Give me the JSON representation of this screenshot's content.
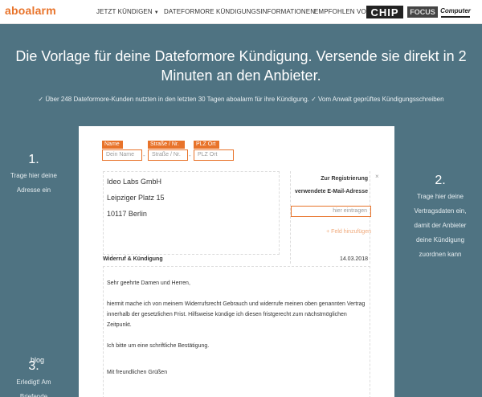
{
  "header": {
    "logo": "aboalarm",
    "nav": {
      "kuendigen": "JETZT KÜNDIGEN",
      "info": "DATEFORMORE KÜNDIGUNGSINFORMATIONEN",
      "empfohlen": "EMPFOHLEN VON"
    },
    "brands": [
      "CHIP",
      "FOCUS",
      "Computer"
    ]
  },
  "hero": {
    "title": "Die Vorlage für deine Dateformore Kündigung. Versende sie direkt in 2 Minuten an den Anbieter.",
    "subtitle": "✓ Über 248 Dateformore-Kunden nutzten in den letzten 30 Tagen aboalarm für ihre Kündigung. ✓ Vom Anwalt geprüftes Kündigungsschreiben"
  },
  "steps": [
    {
      "num": "1.",
      "text": "Trage hier deine Adresse ein"
    },
    {
      "num": "2.",
      "text": "Trage hier deine Vertragsdaten ein, damit der Anbieter deine Kündigung zuordnen kann"
    },
    {
      "num": "3.",
      "text": "Erledigt! Am Briefende",
      "extra": "blog"
    }
  ],
  "sender": {
    "name_label": "Name",
    "name_placeholder": "Dein Name",
    "street_label": "Straße / Nr.",
    "street_placeholder": "Straße / Nr.",
    "plz_label": "PLZ Ort",
    "plz_placeholder": "PLZ Ort"
  },
  "recipient": {
    "line1": "Ideo Labs GmbH",
    "line2": "Leipziger Platz 15",
    "line3": "10117 Berlin"
  },
  "registration": {
    "label": "Zur Registrierung verwendete E-Mail-Adresse",
    "placeholder": "hier eintragen",
    "add_field": "+ Feld hinzufügen",
    "close": "×"
  },
  "letter": {
    "subject": "Widerruf & Kündigung",
    "date": "14.03.2018",
    "greeting": "Sehr geehrte Damen und Herren,",
    "paragraph": "hiermit mache ich von meinem Widerrufsrecht Gebrauch und widerrufe meinen oben genannten Vertrag innerhalb der gesetzlichen Frist. Hilfsweise kündige ich diesen fristgerecht zum nächstmöglichen Zeitpunkt.",
    "request": "Ich bitte um eine schriftliche Bestätigung.",
    "closing": "Mit freundlichen Grüßen"
  },
  "colors": {
    "accent": "#e8732a",
    "hero_bg": "#4f7382"
  }
}
